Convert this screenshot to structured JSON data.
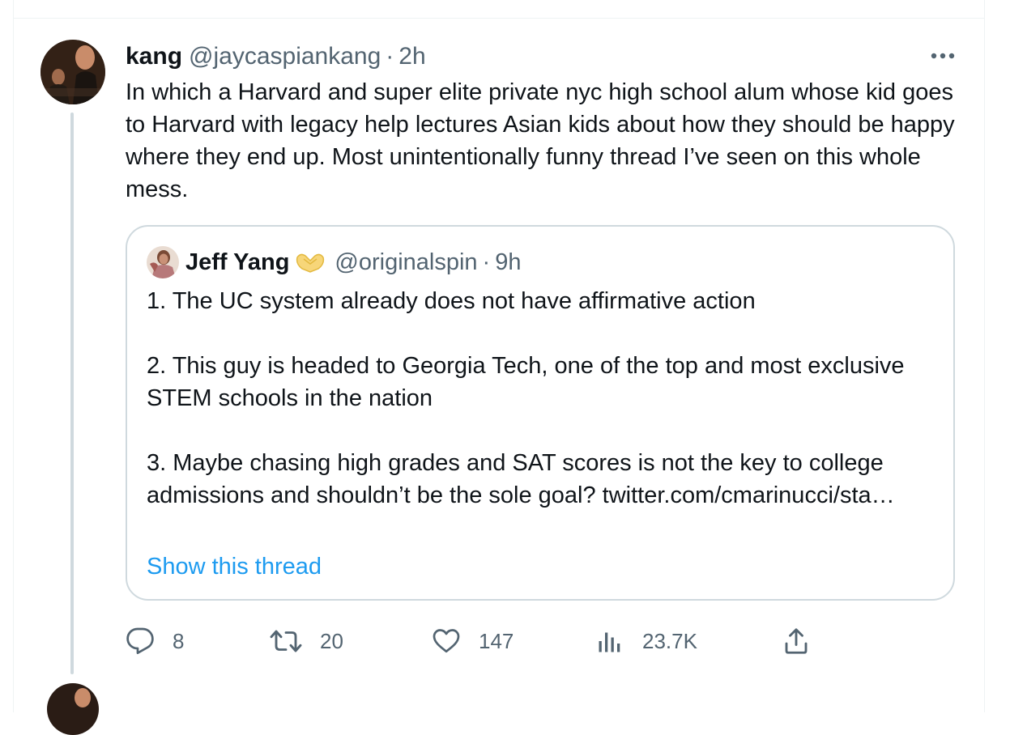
{
  "tweet": {
    "author_name": "kang",
    "author_handle": "@jaycaspiankang",
    "separator": "·",
    "time": "2h",
    "text": "In which a Harvard and super elite private nyc high school alum whose kid goes to Harvard with legacy help lectures Asian kids about how they should be happy where they end up. Most unintentionally funny thread I’ve seen on this whole mess.",
    "more_icon": "more-horizontal-icon"
  },
  "quoted": {
    "author_name": "Jeff Yang",
    "badge_icon": "heart-hands-emoji-icon",
    "author_handle": "@originalspin",
    "separator": "·",
    "time": "9h",
    "paragraphs": [
      "1. The UC system already does not have affirmative action",
      "2. This guy is headed to Georgia Tech, one of the top and most exclusive STEM schools in the nation",
      "3. Maybe chasing high grades and SAT scores is not the key to college admissions and shouldn’t be the sole goal? twitter.com/cmarinucci/sta…"
    ],
    "show_thread_label": "Show this thread"
  },
  "actions": {
    "reply": {
      "icon": "reply-icon",
      "count": "8"
    },
    "retweet": {
      "icon": "retweet-icon",
      "count": "20"
    },
    "like": {
      "icon": "heart-icon",
      "count": "147"
    },
    "views": {
      "icon": "views-icon",
      "count": "23.7K"
    },
    "share": {
      "icon": "share-icon"
    }
  },
  "colors": {
    "text": "#0f1419",
    "secondary": "#536471",
    "link": "#1d9bf0",
    "border": "#cfd9de",
    "badge": "#f7d679"
  }
}
